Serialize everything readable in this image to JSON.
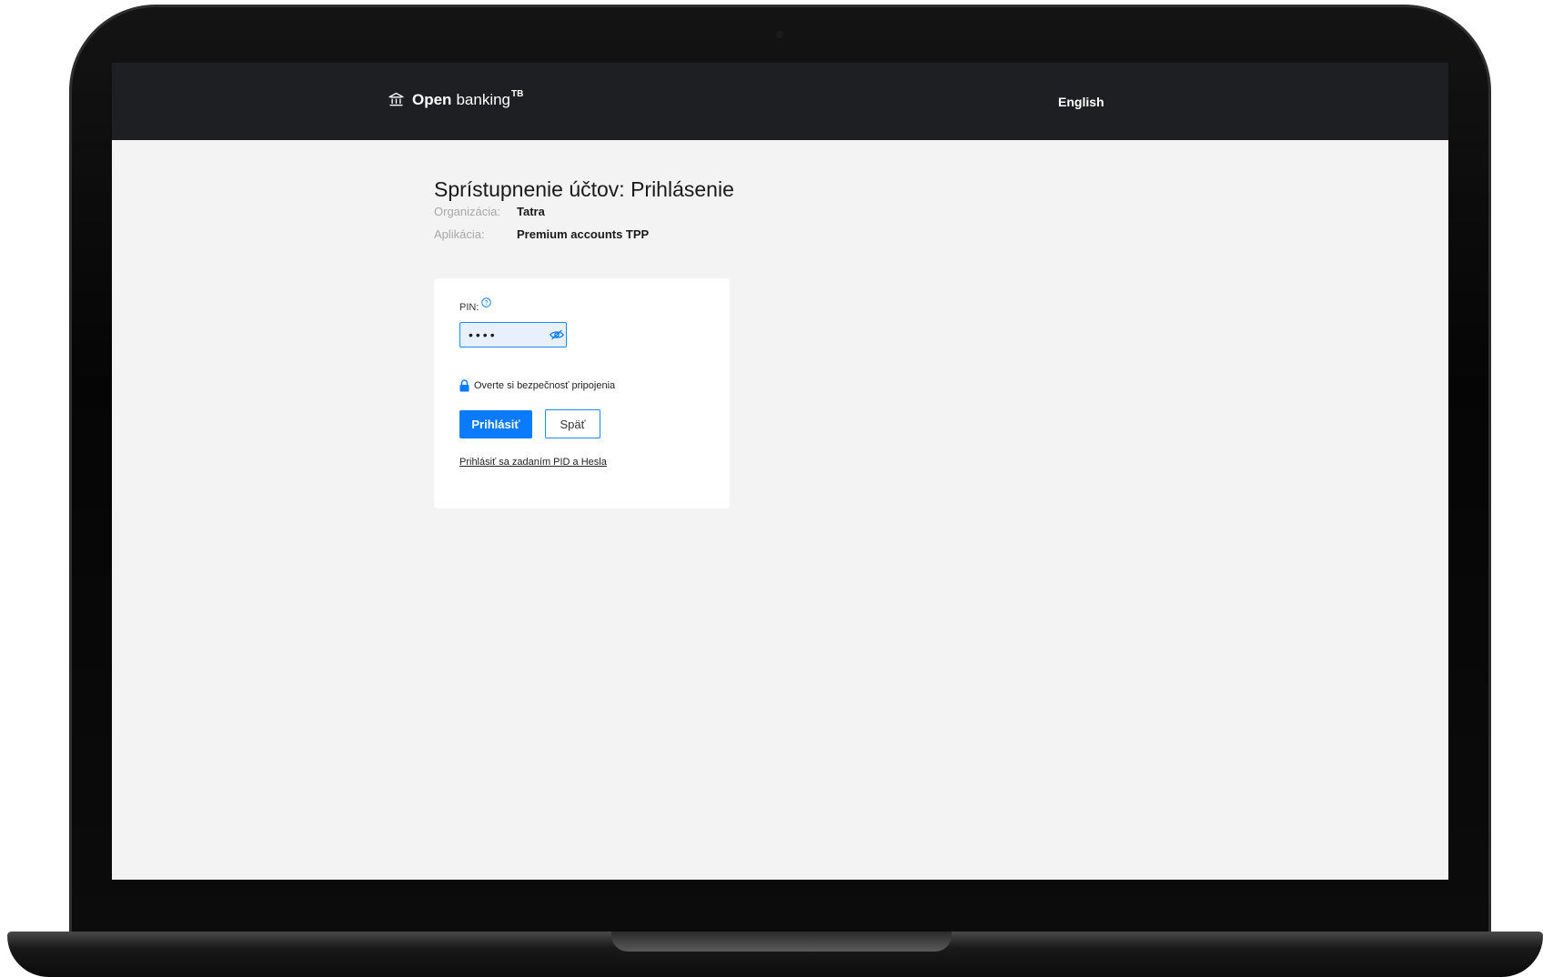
{
  "header": {
    "brand_bold": "Open",
    "brand_rest": "banking",
    "brand_sup": "TB",
    "language": "English"
  },
  "page": {
    "title": "Sprístupnenie účtov: Prihlásenie"
  },
  "meta": {
    "organization_label": "Organizácia:",
    "organization_value": "Tatra",
    "application_label": "Aplikácia:",
    "application_value": "Premium accounts TPP"
  },
  "form": {
    "pin_label": "PIN:",
    "pin_value": "••••",
    "security_text": "Overte si bezpečnosť pripojenia",
    "login_button": "Prihlásiť",
    "back_button": "Späť",
    "alt_login_link": "Prihlásiť sa zadaním PID a Hesla"
  },
  "colors": {
    "accent": "#0a7aff",
    "header_bg": "#1e1f22",
    "page_bg": "#f3f3f3"
  },
  "icons": {
    "brand": "bank-icon",
    "help": "help-circle-icon",
    "toggle_visibility": "eye-slash-icon",
    "security": "lock-icon"
  }
}
